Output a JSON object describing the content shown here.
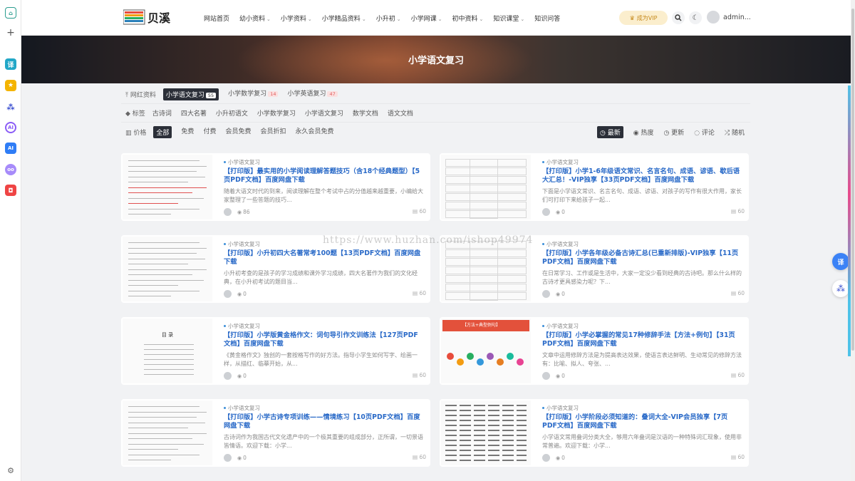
{
  "header": {
    "logo_text": "贝溪",
    "nav": [
      {
        "label": "网站首页",
        "dropdown": false
      },
      {
        "label": "幼小资料",
        "dropdown": true
      },
      {
        "label": "小学资料",
        "dropdown": true
      },
      {
        "label": "小学精品资料",
        "dropdown": true
      },
      {
        "label": "小升初",
        "dropdown": true
      },
      {
        "label": "小学网课",
        "dropdown": true
      },
      {
        "label": "初中资料",
        "dropdown": true
      },
      {
        "label": "知识课堂",
        "dropdown": true
      },
      {
        "label": "知识问答",
        "dropdown": false
      }
    ],
    "vip_label": "成为VIP",
    "username": "admin..."
  },
  "banner": {
    "title": "小学语文复习"
  },
  "filters": {
    "category_row": {
      "label": "网红资料",
      "options": [
        {
          "label": "小学语文复习",
          "count": "55",
          "active": true
        },
        {
          "label": "小学数学复习",
          "count": "14",
          "active": false
        },
        {
          "label": "小学英语复习",
          "count": "47",
          "active": false
        }
      ]
    },
    "tag_row": {
      "label": "标签",
      "options": [
        "古诗词",
        "四大名著",
        "小升初语文",
        "小学数学复习",
        "小学语文复习",
        "数学文档",
        "语文文档"
      ]
    },
    "price_row": {
      "label": "价格",
      "options": [
        {
          "label": "全部",
          "active": true
        },
        {
          "label": "免费",
          "active": false
        },
        {
          "label": "付费",
          "active": false
        },
        {
          "label": "会员免费",
          "active": false
        },
        {
          "label": "会员折扣",
          "active": false
        },
        {
          "label": "永久会员免费",
          "active": false
        }
      ]
    },
    "sort": [
      {
        "label": "最新",
        "active": true
      },
      {
        "label": "热度",
        "active": false
      },
      {
        "label": "更新",
        "active": false
      },
      {
        "label": "评论",
        "active": false
      },
      {
        "label": "随机",
        "active": false
      }
    ]
  },
  "posts": [
    {
      "category": "小学语文复习",
      "title": "【打印版】最实用的小学阅读理解答题技巧（含18个经典题型）【5页PDF文档】百度网盘下载",
      "desc": "随着大语文时代的到来，阅读理解在整个考试中占的分值越来越重要，小编给大家整理了一些答题的技巧...",
      "views": "86",
      "count": "60"
    },
    {
      "category": "小学语文复习",
      "title": "【打印版】小学1-6年级语文常识、名言名句、成语、谚语、歇后语大汇总！-VIP独享【33页PDF文档】百度网盘下载",
      "desc": "下面是小学语文常识、名言名句、成语、谚语、对孩子的写作有很大作用，家长们可打印下来给孩子一起...",
      "views": "0",
      "count": "60"
    },
    {
      "category": "小学语文复习",
      "title": "【打印版】小升初四大名著常考100题【13页PDF文档】百度网盘下载",
      "desc": "小升初考查的是孩子的学习成绩和课外学习成绩，四大名著作为我们的文化经典，在小升初考试的题目当...",
      "views": "0",
      "count": "60"
    },
    {
      "category": "小学语文复习",
      "title": "【打印版】小学各年级必备古诗汇总(已重新排版)-VIP独享【11页PDF文档】百度网盘下载",
      "desc": "在日常学习、工作或是生活中，大家一定没少看到经典的古诗吧。那么什么样的古诗才更具感染力呢？下...",
      "views": "0",
      "count": "60"
    },
    {
      "category": "小学语文复习",
      "title": "【打印版】小学版黄金格作文：词句导引作文训练法【127页PDF文档】百度网盘下载",
      "desc": "《黄金格作文》独创的一套按格写作的好方法。指导小学生如何写字、绘画一样，从描红、临摹开始，从...",
      "views": "0",
      "count": "60"
    },
    {
      "category": "小学语文复习",
      "title": "【打印版】小学必掌握的常见17种修辞手法【方法+例句】【31页PDF文档】百度网盘下载",
      "desc": "文章中运用修辞方法是为提高表达效果，使语言表达鲜明、生动常见的修辞方法有：比喻、拟人、夸张、...",
      "views": "0",
      "count": "60",
      "thumb_banner": "【方法+典型例句】"
    },
    {
      "category": "小学语文复习",
      "title": "【打印版】小学古诗专项训练——情境练习【10页PDF文档】百度网盘下载",
      "desc": "古诗词作为我国古代文化遗产中的一个极其重要的组成部分，正所谓，一切景语皆情语。欢迎下载：小学...",
      "views": "0",
      "count": "60"
    },
    {
      "category": "小学语文复习",
      "title": "【打印版】小学阶段必须知道的：叠词大全-VIP会员独享【7页PDF文档】百度网盘下载",
      "desc": "小学语文常用叠词分类大全，够用六年叠词是汉语的一种特殊词汇现象，使用非常普遍。欢迎下载：小学...",
      "views": "0",
      "count": "60"
    }
  ],
  "thumb_toc": {
    "heading": "目  录"
  },
  "watermark": "https://www.huzhan.com/ishop49974"
}
